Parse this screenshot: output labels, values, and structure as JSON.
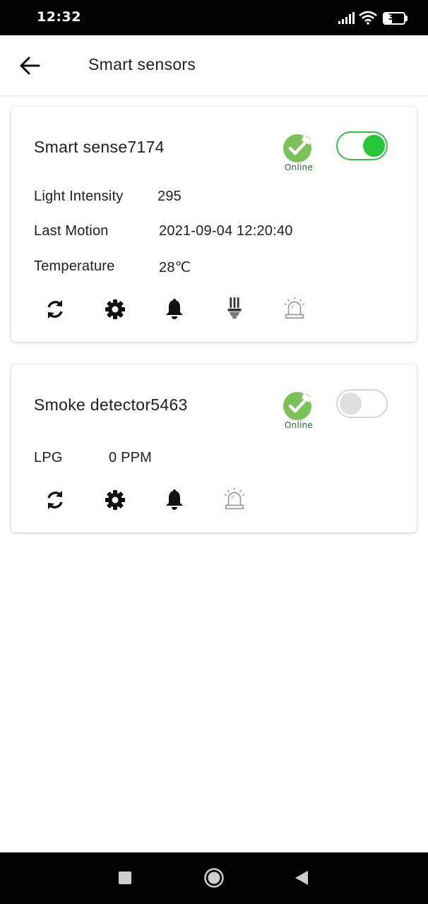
{
  "status_bar": {
    "time": "12:32",
    "battery": "38",
    "battery_level": 0.38
  },
  "header": {
    "title": "Smart sensors"
  },
  "cards": [
    {
      "name": "Smart sense7174",
      "status": "Online",
      "enabled": true,
      "fields": [
        {
          "label": "Light Intensity",
          "value": "295"
        },
        {
          "label": "Last Motion",
          "value": "2021-09-04 12:20:40"
        },
        {
          "label": "Temperature",
          "value": "28℃"
        }
      ],
      "actions": [
        "refresh-icon",
        "settings-icon",
        "bell-icon",
        "bulb-icon",
        "siren-icon"
      ]
    },
    {
      "name": "Smoke detector5463",
      "status": "Online",
      "enabled": false,
      "fields": [
        {
          "label": "LPG",
          "value": "0 PPM"
        }
      ],
      "actions": [
        "refresh-icon",
        "settings-icon",
        "bell-icon",
        "siren-icon"
      ]
    }
  ],
  "colors": {
    "toggle_on": "#27c73a",
    "status_badge": "#7dc15a",
    "status_text": "#2b6b2b"
  }
}
